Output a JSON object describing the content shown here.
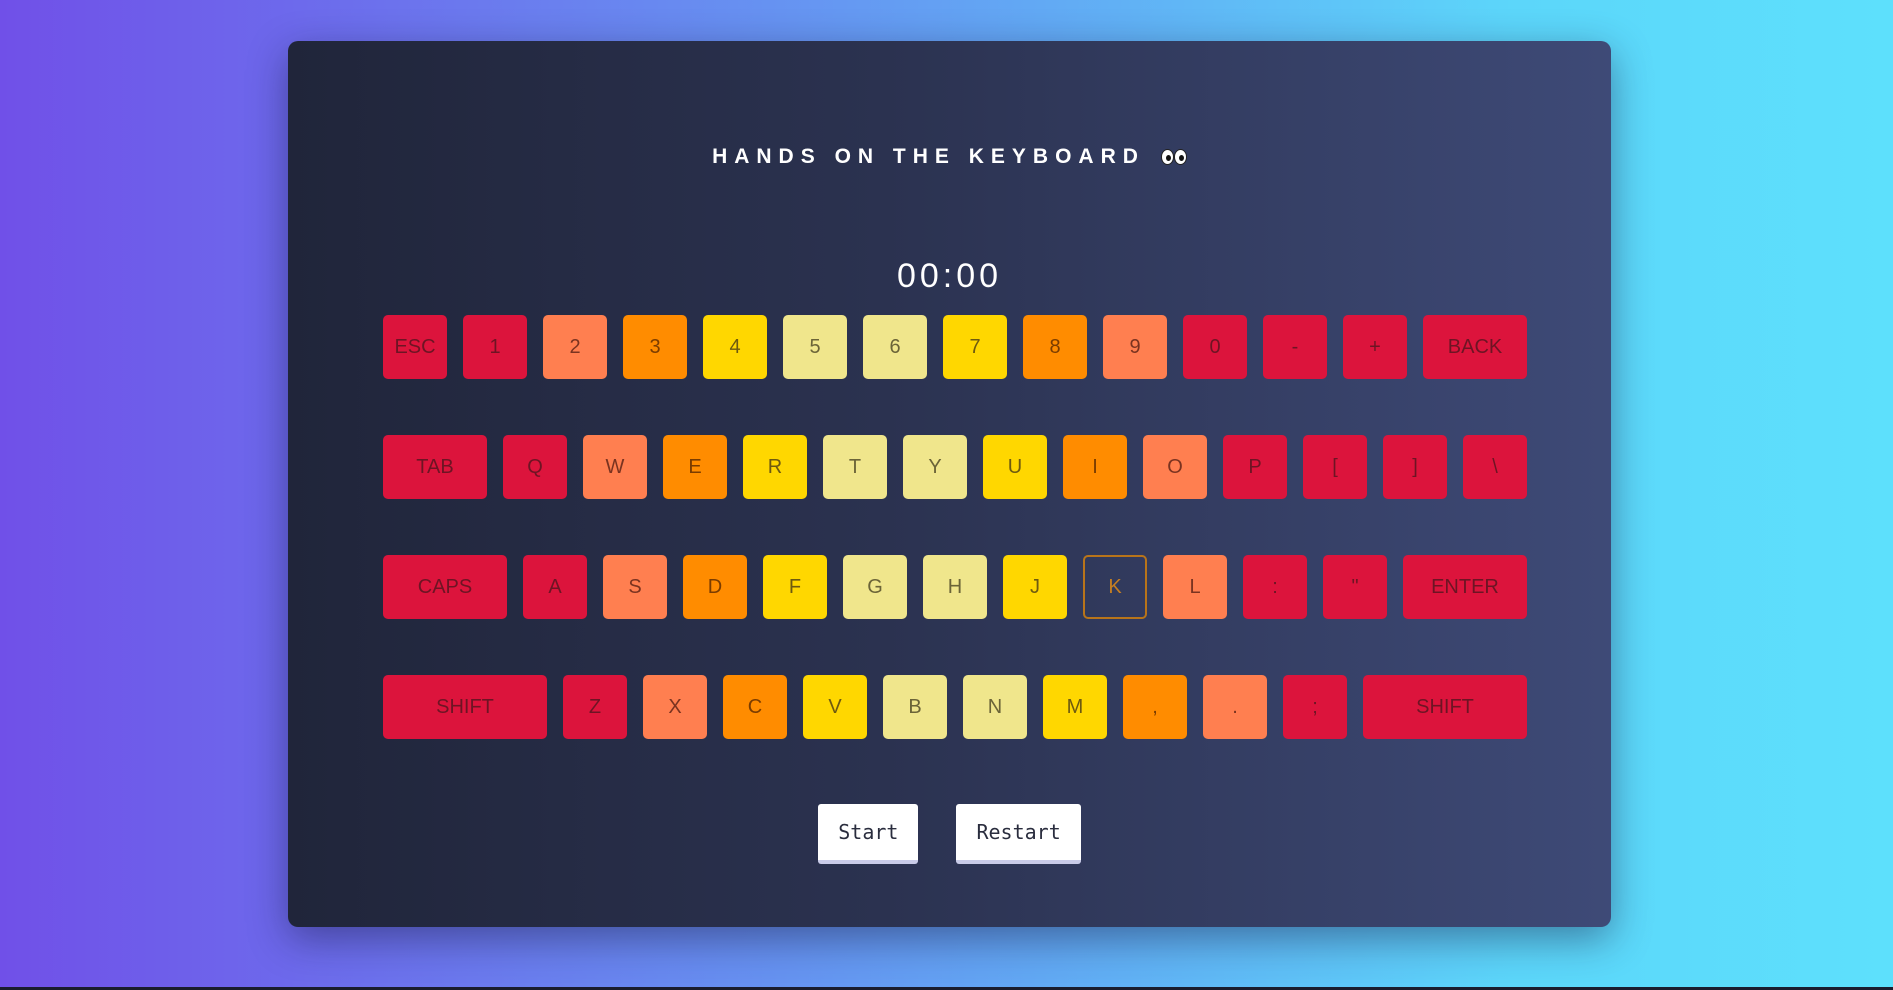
{
  "title": "HANDS ON THE KEYBOARD",
  "timer": "00:00",
  "colors": {
    "red": "#dc143c",
    "coral": "#ff7f50",
    "orange": "#ff8c00",
    "gold": "#ffd700",
    "khaki": "#f0e68c"
  },
  "rows": [
    [
      {
        "label": "ESC",
        "color": "red",
        "w": 64
      },
      {
        "label": "1",
        "color": "red",
        "w": 64
      },
      {
        "label": "2",
        "color": "coral",
        "w": 64
      },
      {
        "label": "3",
        "color": "orange",
        "w": 64
      },
      {
        "label": "4",
        "color": "gold",
        "w": 64
      },
      {
        "label": "5",
        "color": "khaki",
        "w": 64
      },
      {
        "label": "6",
        "color": "khaki",
        "w": 64
      },
      {
        "label": "7",
        "color": "gold",
        "w": 64
      },
      {
        "label": "8",
        "color": "orange",
        "w": 64
      },
      {
        "label": "9",
        "color": "coral",
        "w": 64
      },
      {
        "label": "0",
        "color": "red",
        "w": 64
      },
      {
        "label": "-",
        "color": "red",
        "w": 64
      },
      {
        "label": "+",
        "color": "red",
        "w": 64
      },
      {
        "label": "BACK",
        "color": "red",
        "w": 104
      }
    ],
    [
      {
        "label": "TAB",
        "color": "red",
        "w": 104
      },
      {
        "label": "Q",
        "color": "red",
        "w": 64
      },
      {
        "label": "W",
        "color": "coral",
        "w": 64
      },
      {
        "label": "E",
        "color": "orange",
        "w": 64
      },
      {
        "label": "R",
        "color": "gold",
        "w": 64
      },
      {
        "label": "T",
        "color": "khaki",
        "w": 64
      },
      {
        "label": "Y",
        "color": "khaki",
        "w": 64
      },
      {
        "label": "U",
        "color": "gold",
        "w": 64
      },
      {
        "label": "I",
        "color": "orange",
        "w": 64
      },
      {
        "label": "O",
        "color": "coral",
        "w": 64
      },
      {
        "label": "P",
        "color": "red",
        "w": 64
      },
      {
        "label": "[",
        "color": "red",
        "w": 64
      },
      {
        "label": "]",
        "color": "red",
        "w": 64
      },
      {
        "label": "\\",
        "color": "red",
        "w": 64
      }
    ],
    [
      {
        "label": "CAPS",
        "color": "red",
        "w": 124
      },
      {
        "label": "A",
        "color": "red",
        "w": 64
      },
      {
        "label": "S",
        "color": "coral",
        "w": 64
      },
      {
        "label": "D",
        "color": "orange",
        "w": 64
      },
      {
        "label": "F",
        "color": "gold",
        "w": 64
      },
      {
        "label": "G",
        "color": "khaki",
        "w": 64
      },
      {
        "label": "H",
        "color": "khaki",
        "w": 64
      },
      {
        "label": "J",
        "color": "gold",
        "w": 64
      },
      {
        "label": "K",
        "color": "outline",
        "w": 64
      },
      {
        "label": "L",
        "color": "coral",
        "w": 64
      },
      {
        "label": ":",
        "color": "red",
        "w": 64
      },
      {
        "label": "\"",
        "color": "red",
        "w": 64
      },
      {
        "label": "ENTER",
        "color": "red",
        "w": 124
      }
    ],
    [
      {
        "label": "SHIFT",
        "color": "red",
        "w": 164
      },
      {
        "label": "Z",
        "color": "red",
        "w": 64
      },
      {
        "label": "X",
        "color": "coral",
        "w": 64
      },
      {
        "label": "C",
        "color": "orange",
        "w": 64
      },
      {
        "label": "V",
        "color": "gold",
        "w": 64
      },
      {
        "label": "B",
        "color": "khaki",
        "w": 64
      },
      {
        "label": "N",
        "color": "khaki",
        "w": 64
      },
      {
        "label": "M",
        "color": "gold",
        "w": 64
      },
      {
        "label": ",",
        "color": "orange",
        "w": 64
      },
      {
        "label": ".",
        "color": "coral",
        "w": 64
      },
      {
        "label": ";",
        "color": "red",
        "w": 64
      },
      {
        "label": "SHIFT",
        "color": "red",
        "w": 164
      }
    ]
  ],
  "controls": {
    "start_label": "Start",
    "restart_label": "Restart"
  }
}
